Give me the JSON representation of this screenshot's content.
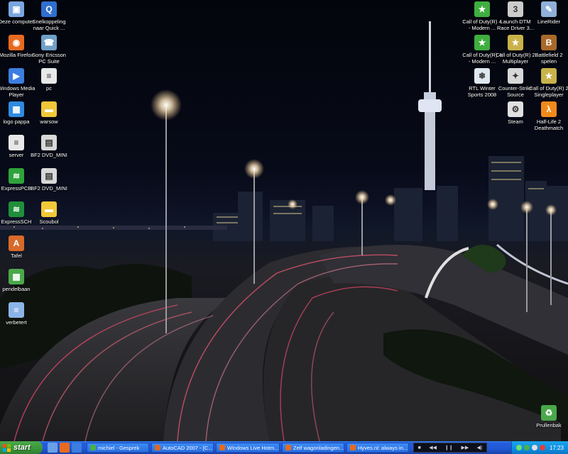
{
  "desktop": {
    "left_icons": [
      {
        "label": "Deze computer",
        "icon": "computer-icon",
        "color": "#7aa6e0"
      },
      {
        "label": "Snelkoppeling naar Quick ...",
        "icon": "quicktime-icon",
        "color": "#2f6fd0"
      },
      {
        "label": "Mozilla Firefox",
        "icon": "firefox-icon",
        "color": "#e86a1f"
      },
      {
        "label": "Sony Ericsson PC Suite",
        "icon": "phone-icon",
        "color": "#6fa0c8"
      },
      {
        "label": "Windows Media Player",
        "icon": "media-player-icon",
        "color": "#3c7de0"
      },
      {
        "label": "pc",
        "icon": "document-icon",
        "color": "#e8e8e8"
      },
      {
        "label": "logo pappa",
        "icon": "image-file-icon",
        "color": "#2f8be0"
      },
      {
        "label": "warsow",
        "icon": "folder-icon",
        "color": "#f0c838"
      },
      {
        "label": "server",
        "icon": "document-icon",
        "color": "#e8e8e8"
      },
      {
        "label": "BF2 DVD_MINI",
        "icon": "disk-image-icon",
        "color": "#d8d8d8"
      },
      {
        "label": "ExpressPCB",
        "icon": "pcb-icon",
        "color": "#2fa33a"
      },
      {
        "label": "BF2 DVD_MINI",
        "icon": "disk-image-icon",
        "color": "#d8d8d8"
      },
      {
        "label": "ExpressSCH",
        "icon": "schematic-icon",
        "color": "#1f8f3a"
      },
      {
        "label": "Scoubol",
        "icon": "folder-icon",
        "color": "#f0c838"
      },
      {
        "label": "Tafel",
        "icon": "autocad-file-icon",
        "color": "#d86a2a"
      },
      {
        "label": "pendelbaan",
        "icon": "image-file-icon",
        "color": "#4aa84a"
      },
      {
        "label": "verbetert",
        "icon": "document-icon",
        "color": "#8cb4e8"
      }
    ],
    "right_icons": [
      {
        "label": "Call of Duty(R) 4 - Modern ...",
        "icon": "cod4-icon",
        "color": "#3fae3f"
      },
      {
        "label": "Launch DTM Race Driver 3...",
        "icon": "race-driver-icon",
        "color": "#cccccc"
      },
      {
        "label": "LineRider",
        "icon": "linerider-icon",
        "color": "#8fb0d8"
      },
      {
        "label": "Call of Duty(R) 4 - Modern ...",
        "icon": "cod4-icon",
        "color": "#3fae3f"
      },
      {
        "label": "Call of Duty(R) 2 Multiplayer",
        "icon": "cod2-icon",
        "color": "#c9b24a"
      },
      {
        "label": "Battlefield 2 spelen",
        "icon": "battlefield-icon",
        "color": "#a86a2a"
      },
      {
        "label": "RTL Winter Sports 2008",
        "icon": "winter-sports-icon",
        "color": "#dfe8f0"
      },
      {
        "label": "Counter-Strike Source",
        "icon": "counter-strike-icon",
        "color": "#d8d8d8"
      },
      {
        "label": "Call of Duty(R) 2 Singleplayer",
        "icon": "cod2-icon",
        "color": "#c9b24a"
      },
      {
        "label": "Steam",
        "icon": "steam-icon",
        "color": "#e0e0e0"
      },
      {
        "label": "Half-Life 2 Deathmatch",
        "icon": "half-life-icon",
        "color": "#f08a1a"
      }
    ],
    "recycle_bin": {
      "label": "Prullenbak",
      "icon": "recycle-bin-icon",
      "color": "#4aa84a"
    }
  },
  "taskbar": {
    "start_label": "start",
    "quick_launch": [
      {
        "icon": "show-desktop-icon",
        "color": "#6aa0e8"
      },
      {
        "icon": "firefox-icon",
        "color": "#e86a1f"
      },
      {
        "icon": "media-player-icon",
        "color": "#3c7de0"
      }
    ],
    "buttons": [
      {
        "label": "michiel - Gesprek",
        "icon": "messenger-icon",
        "color": "#4ab04a",
        "width": 88
      },
      {
        "label": "AutoCAD 2007 - [C...",
        "icon": "autocad-icon",
        "color": "#d86a2a",
        "width": 88
      },
      {
        "label": "Windows Live Hotm...",
        "icon": "firefox-icon",
        "color": "#e86a1f",
        "width": 90
      },
      {
        "label": "Zelf wagonladingen...",
        "icon": "firefox-icon",
        "color": "#e86a1f",
        "width": 88
      },
      {
        "label": "Hyves.nl: always in...",
        "icon": "firefox-icon",
        "color": "#e86a1f",
        "width": 88
      }
    ],
    "media_controls": [
      "■",
      "◀◀",
      "❙❙",
      "▶▶",
      "◀)"
    ],
    "tray_icons": [
      {
        "icon": "network-icon",
        "color": "#6fe06f"
      },
      {
        "icon": "messenger-tray-icon",
        "color": "#4ab04a"
      },
      {
        "icon": "volume-icon",
        "color": "#e0e0e0"
      },
      {
        "icon": "security-icon",
        "color": "#e04040"
      }
    ],
    "clock": "17:23"
  }
}
